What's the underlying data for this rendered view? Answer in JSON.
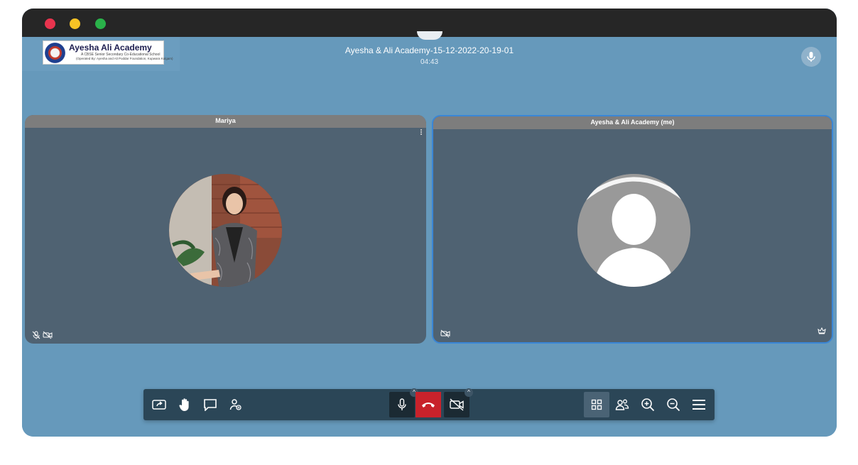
{
  "window": {
    "controls": [
      "close",
      "minimize",
      "maximize"
    ],
    "colors": {
      "close": "#e8344e",
      "minimize": "#f7c325",
      "maximize": "#2ab24a"
    }
  },
  "header": {
    "logo": {
      "name": "Ayesha Ali Academy",
      "subtitle_line1": "A CBSE Senior Secondary Co-Educational School",
      "subtitle_line2": "(Operated By: Ayesha and Ali Poddar Foundation, Kupwara Kulgam)",
      "subtitle_line3": "Foundation, Kupwara Kulgam"
    },
    "meeting_title": "Ayesha & Ali Academy-15-12-2022-20-19-01",
    "timer": "04:43",
    "mic_icon": "microphone-icon"
  },
  "tiles": [
    {
      "name": "Mariya",
      "avatar": "photo",
      "status_icons": [
        "mic-muted-icon",
        "camera-off-icon"
      ]
    },
    {
      "name": "Ayesha & Ali Academy (me)",
      "avatar": "default",
      "status_icons": [
        "camera-off-icon"
      ],
      "badge_icon": "crown-icon",
      "active_speaker": true
    }
  ],
  "toolbar": {
    "left": [
      "share-screen-icon",
      "raise-hand-icon",
      "chat-icon",
      "participants-icon"
    ],
    "center": [
      "microphone-icon",
      "hangup-icon",
      "camera-off-icon"
    ],
    "right": [
      "tile-view-icon",
      "breakout-rooms-icon",
      "zoom-in-icon",
      "zoom-out-icon",
      "menu-icon"
    ],
    "caret": "^",
    "hangup_color": "#c8222b",
    "bar_color": "#2b4657"
  },
  "colors": {
    "stage": "#6699bb",
    "tile": "#4f6272",
    "tile_header": "#7d7d7d",
    "active_border": "#3a86d6",
    "titlebar": "#262626"
  }
}
